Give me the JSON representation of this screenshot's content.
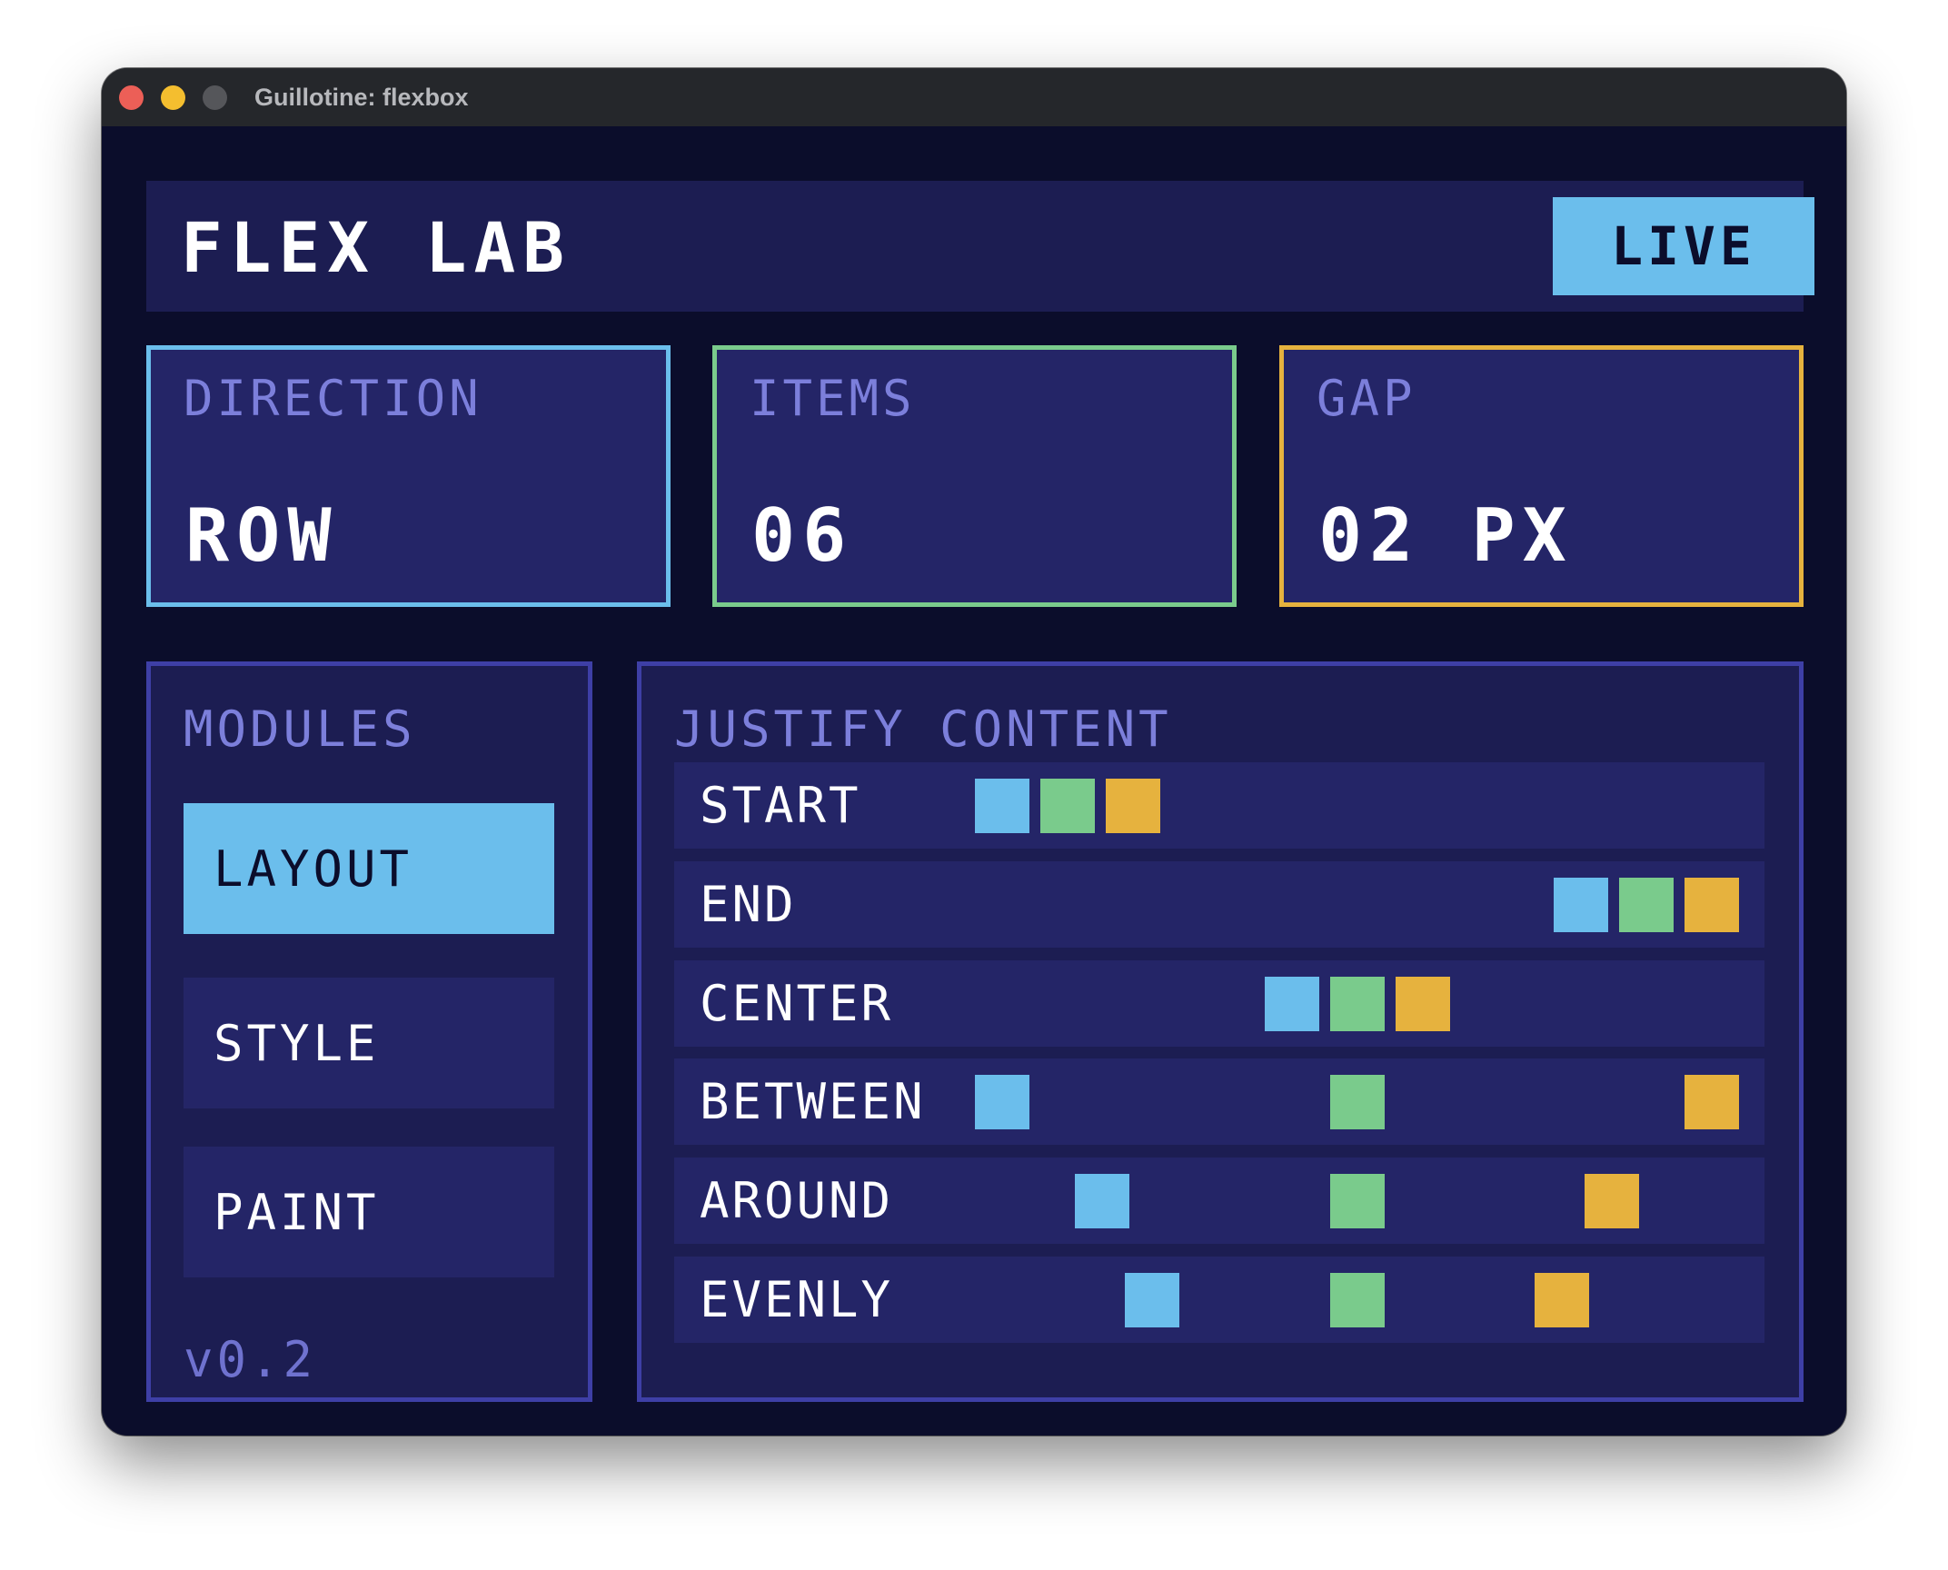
{
  "window": {
    "title": "Guillotine: flexbox"
  },
  "header": {
    "title": "FLEX LAB",
    "live_label": "LIVE"
  },
  "stats": [
    {
      "label": "DIRECTION",
      "value": "ROW"
    },
    {
      "label": "ITEMS",
      "value": "06"
    },
    {
      "label": "GAP",
      "value": "02 PX"
    }
  ],
  "modules": {
    "label": "MODULES",
    "items": [
      "LAYOUT",
      "STYLE",
      "PAINT"
    ],
    "active": "LAYOUT",
    "version": "v0.2"
  },
  "justify": {
    "label": "JUSTIFY CONTENT",
    "rows": [
      {
        "label": "START",
        "mode": "start"
      },
      {
        "label": "END",
        "mode": "end"
      },
      {
        "label": "CENTER",
        "mode": "center"
      },
      {
        "label": "BETWEEN",
        "mode": "between"
      },
      {
        "label": "AROUND",
        "mode": "around"
      },
      {
        "label": "EVENLY",
        "mode": "evenly"
      }
    ]
  },
  "colors": {
    "blue": "#6bbeec",
    "green": "#7acb8c",
    "orange": "#e6b23e"
  }
}
